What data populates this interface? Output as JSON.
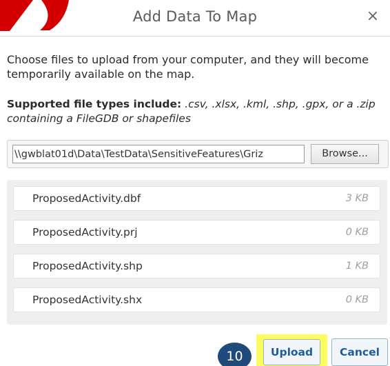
{
  "dialog": {
    "title": "Add Data To Map",
    "close_icon": "close-icon",
    "close_glyph": "×",
    "intro_text": "Choose files to upload from your computer, and they will become temporarily available on the map.",
    "supported_label": "Supported file types include:",
    "supported_types": " .csv, .xlsx, .kml, .shp, .gpx, or a .zip containing a FileGDB or shapefiles",
    "file_path_value": "\\\\gwblat01d\\Data\\TestData\\SensitiveFeatures\\Griz",
    "browse_label": "Browse...",
    "files": [
      {
        "name": "ProposedActivity.dbf",
        "size": "3 KB"
      },
      {
        "name": "ProposedActivity.prj",
        "size": "0 KB"
      },
      {
        "name": "ProposedActivity.shp",
        "size": "1 KB"
      },
      {
        "name": "ProposedActivity.shx",
        "size": "0 KB"
      }
    ],
    "step_badge": "10",
    "upload_label": "Upload",
    "cancel_label": "Cancel"
  },
  "colors": {
    "highlight": "#fbfd5e",
    "badge": "#1f4a7a",
    "button_text": "#1d5d99",
    "corner_mark": "#d40000"
  }
}
